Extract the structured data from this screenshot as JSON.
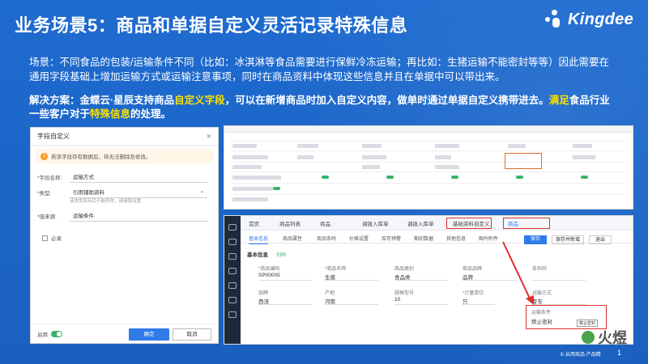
{
  "header": {
    "title": "业务场景5：商品和单据自定义灵活记录特殊信息",
    "logo_text": "Kingdee"
  },
  "scene_text": "场景：不同食品的包装/运输条件不同（比如：冰淇淋等食品需要进行保鲜冷冻运输；再比如：生猪运输不能密封等等）因此需要在通用字段基础上增加运输方式或运输注意事项，同时在商品资料中体现这些信息并且在单据中可以带出来。",
  "solution": {
    "prefix": "解决方案：金蝶云·星辰支持商品",
    "highlight1": "自定义字段",
    "mid": "，可以在新增商品时加入自定义内容，做单时通过单据自定义携带进去。",
    "highlight2": "满足",
    "mid2": "食品行业一些客户对于",
    "highlight3": "特殊信息",
    "suffix": "的处理。"
  },
  "dialog": {
    "title": "字段自定义",
    "warning": "若该字段存有数据后，将无法删除及修改。",
    "name_label": "*字段名称:",
    "name_value": "运输方式",
    "type_label": "*类型:",
    "type_value": "引用辅助资料",
    "type_hint": "该类型保存后不能修改，请谨慎设置",
    "source_label": "*值来源:",
    "source_value": "运输条件",
    "required_label": "必录",
    "enable_label": "启用",
    "ok_label": "确定",
    "cancel_label": "取消"
  },
  "shot2": {
    "tabs": [
      "首页",
      "商品列表",
      "商品",
      "调拨入库单",
      "调拨入库单",
      "基础资料自定义",
      "商品"
    ],
    "subtabs": [
      "基本信息",
      "商品属性",
      "商品条码",
      "价格设置",
      "库存预警",
      "期初数据",
      "其他信息",
      "图片附件"
    ],
    "buttons": {
      "save": "保存",
      "save_new": "保存并新增",
      "exit": "退出"
    },
    "section": "基本信息",
    "section_hint": "扫码",
    "fields": [
      {
        "label": "*商品编码",
        "value": "SP00005"
      },
      {
        "label": "*商品名称",
        "value": "生猪"
      },
      {
        "label": "商品类别",
        "value": "食品类"
      },
      {
        "label": "商品品牌",
        "value": "品牌"
      },
      {
        "label": "条形码",
        "value": ""
      },
      {
        "label": "品牌",
        "value": "西流"
      },
      {
        "label": "产地",
        "value": "河南"
      },
      {
        "label": "规格型号",
        "value": "10"
      },
      {
        "label": "*计量单位",
        "value": "只"
      },
      {
        "label": "运输方式",
        "value": "专车"
      }
    ],
    "popup": {
      "label": "运输条件",
      "value": "禁止密封",
      "badge": "禁止密封"
    }
  },
  "footer": {
    "watermark": "火煜",
    "note": "① 启用商品 产品精",
    "page": "1"
  },
  "colors": {
    "background": "#1f69c9",
    "highlight": "#ffe100",
    "primary_button": "#2f7bea",
    "red_box": "#e0302e"
  }
}
